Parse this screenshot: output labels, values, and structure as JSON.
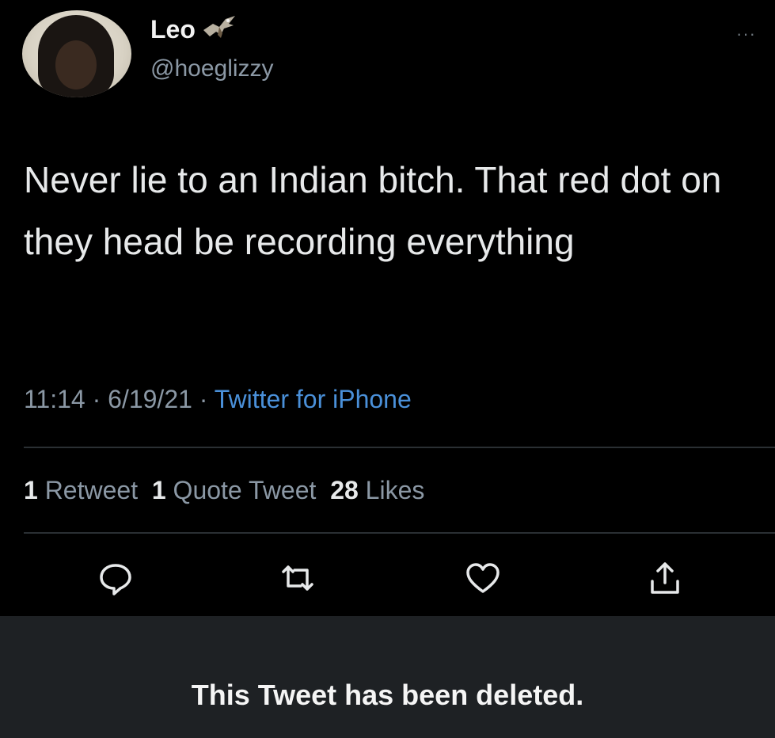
{
  "tweet": {
    "name": "Leo",
    "handle": "@hoeglizzy",
    "more": "···",
    "text": "Never lie to an Indian bitch. That red dot on they head be recording everything",
    "time": "11:14",
    "date": "6/19/21",
    "source": "Twitter for iPhone",
    "stats": {
      "retweets_count": "1",
      "retweets_label": "Retweet",
      "quotes_count": "1",
      "quotes_label": "Quote Tweet",
      "likes_count": "28",
      "likes_label": "Likes"
    },
    "icons": [
      "reply-icon",
      "retweet-icon",
      "like-icon",
      "share-icon"
    ]
  },
  "notice": {
    "text": "This Tweet has been deleted."
  },
  "colors": {
    "background": "#000000",
    "link": "#4a90d9",
    "secondary_text": "#8b98a5",
    "notice_background": "#1e2124"
  }
}
